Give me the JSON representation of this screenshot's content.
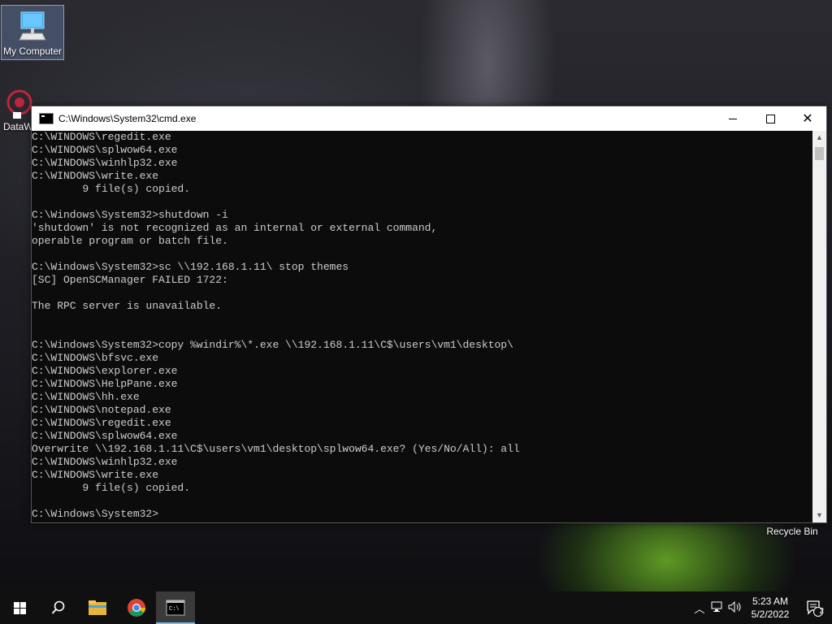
{
  "desktop": {
    "icons": [
      {
        "label": "My Computer"
      },
      {
        "label": "DataW"
      },
      {
        "label": "Recycle Bin"
      }
    ]
  },
  "window": {
    "title": "C:\\Windows\\System32\\cmd.exe",
    "console_lines": [
      "C:\\WINDOWS\\regedit.exe",
      "C:\\WINDOWS\\splwow64.exe",
      "C:\\WINDOWS\\winhlp32.exe",
      "C:\\WINDOWS\\write.exe",
      "        9 file(s) copied.",
      "",
      "C:\\Windows\\System32>shutdown -i",
      "'shutdown' is not recognized as an internal or external command,",
      "operable program or batch file.",
      "",
      "C:\\Windows\\System32>sc \\\\192.168.1.11\\ stop themes",
      "[SC] OpenSCManager FAILED 1722:",
      "",
      "The RPC server is unavailable.",
      "",
      "",
      "C:\\Windows\\System32>copy %windir%\\*.exe \\\\192.168.1.11\\C$\\users\\vm1\\desktop\\",
      "C:\\WINDOWS\\bfsvc.exe",
      "C:\\WINDOWS\\explorer.exe",
      "C:\\WINDOWS\\HelpPane.exe",
      "C:\\WINDOWS\\hh.exe",
      "C:\\WINDOWS\\notepad.exe",
      "C:\\WINDOWS\\regedit.exe",
      "C:\\WINDOWS\\splwow64.exe",
      "Overwrite \\\\192.168.1.11\\C$\\users\\vm1\\desktop\\splwow64.exe? (Yes/No/All): all",
      "C:\\WINDOWS\\winhlp32.exe",
      "C:\\WINDOWS\\write.exe",
      "        9 file(s) copied.",
      "",
      "C:\\Windows\\System32>"
    ]
  },
  "taskbar": {
    "time": "5:23 AM",
    "date": "5/2/2022",
    "notification_count": "2",
    "apps": [
      "start-icon",
      "search-icon",
      "file-explorer-icon",
      "chrome-icon",
      "cmd-icon"
    ]
  }
}
